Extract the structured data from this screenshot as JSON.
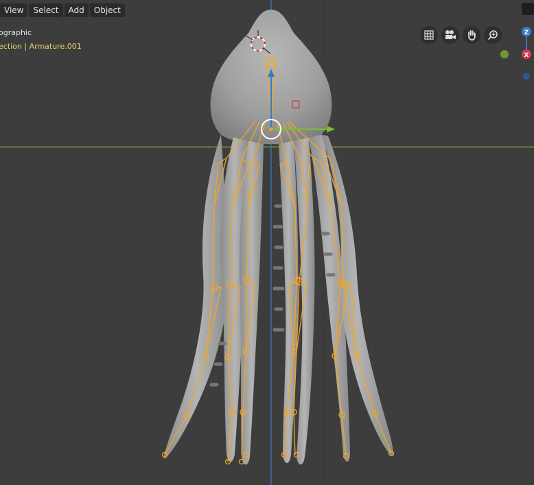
{
  "menu": {
    "items": [
      {
        "label": "View"
      },
      {
        "label": "Select"
      },
      {
        "label": "Add"
      },
      {
        "label": "Object"
      }
    ]
  },
  "overlay": {
    "view_mode": "ographic",
    "collection_line": "ection | Armature.001"
  },
  "navigation": {
    "buttons": [
      "grid-icon",
      "camera-icon",
      "hand-icon",
      "zoom-icon"
    ]
  },
  "gizmo": {
    "z_label": "Z",
    "x_label": "X"
  },
  "colors": {
    "viewport_bg": "#3d3d3d",
    "grid_line": "#353535",
    "x_axis": "#6f9632",
    "z_axis": "#3b7ac2",
    "bone": "#f5a623",
    "mesh": "#9e9e9e"
  }
}
